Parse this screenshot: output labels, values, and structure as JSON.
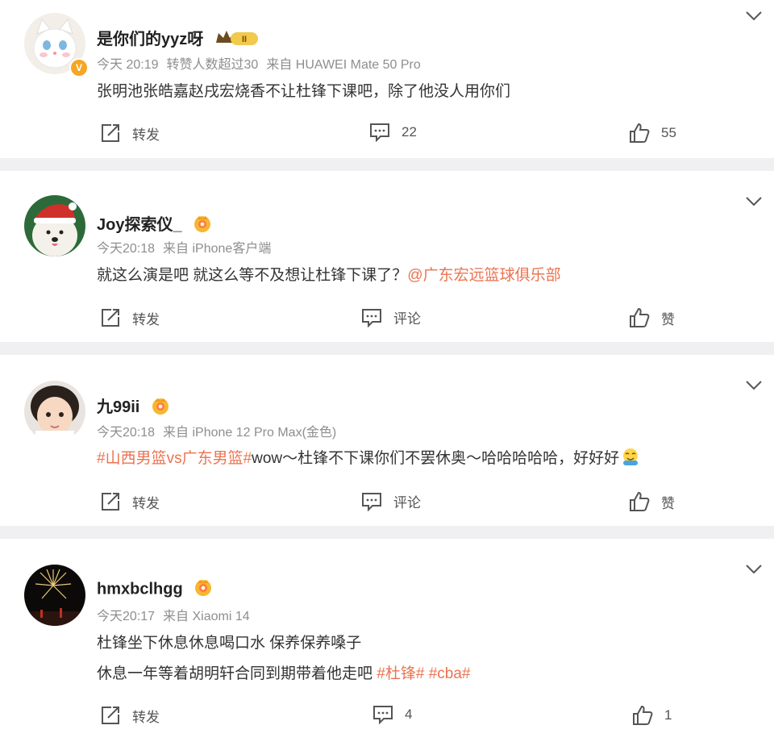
{
  "posts": [
    {
      "username": "是你们的yyz呀",
      "time": "今天 20:19",
      "note": "转赞人数超过30",
      "source": "来自 HUAWEI Mate 50 Pro",
      "text": "张明池张皓嘉赵戌宏烧香不让杜锋下课吧，除了他没人用你们",
      "repost_label": "转发",
      "comment_label": "22",
      "like_label": "55",
      "verified": "V",
      "rank_badge": "II"
    },
    {
      "username": "Joy探索仪_",
      "time": "今天20:18",
      "source": "来自 iPhone客户端",
      "text": "就这么演是吧 就这么等不及想让杜锋下课了？",
      "mention": "@广东宏远篮球俱乐部",
      "repost_label": "转发",
      "comment_label": "评论",
      "like_label": "赞"
    },
    {
      "username": "九99ii",
      "time": "今天20:18",
      "source": "来自 iPhone 12 Pro Max(金色)",
      "topic": "#山西男篮vs广东男篮#",
      "text": "wow～杜锋不下课你们不罢休奥～哈哈哈哈哈，好好好",
      "repost_label": "转发",
      "comment_label": "评论",
      "like_label": "赞"
    },
    {
      "username": "hmxbclhgg",
      "time": "今天20:17",
      "source": "来自 Xiaomi 14",
      "line1": "杜锋坐下休息休息喝口水 保养保养嗓子",
      "line2": "休息一年等着胡明轩合同到期带着他走吧",
      "topic1": "#杜锋#",
      "topic2": "#cba#",
      "repost_label": "转发",
      "comment_label": "4",
      "like_label": "1"
    }
  ],
  "icons": {
    "chevron": "chevron-down-icon",
    "repost": "repost-icon",
    "comment": "comment-icon",
    "like": "like-icon",
    "fan_badge": "fan-badge-icon",
    "emoji": "emoji-icon"
  },
  "colors": {
    "link": "#eb7350",
    "meta": "#8e8e8e",
    "background": "#f0f0f2",
    "badge": "#f5a623"
  }
}
